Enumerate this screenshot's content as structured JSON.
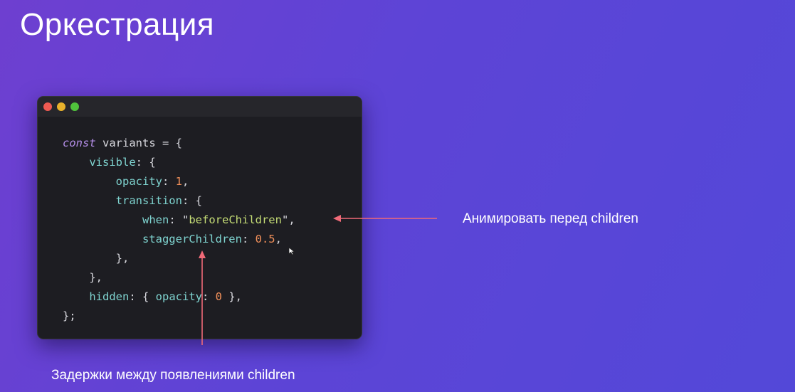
{
  "slide": {
    "title": "Оркестрация"
  },
  "code_window": {
    "lines": [
      {
        "tokens": [
          {
            "t": "const",
            "c": "kw"
          },
          {
            "t": " variants = {",
            "c": "var"
          }
        ]
      },
      {
        "tokens": [
          {
            "t": "    ",
            "c": "var"
          },
          {
            "t": "visible",
            "c": "prop"
          },
          {
            "t": ": {",
            "c": "punct"
          }
        ]
      },
      {
        "tokens": [
          {
            "t": "        ",
            "c": "var"
          },
          {
            "t": "opacity",
            "c": "prop"
          },
          {
            "t": ": ",
            "c": "punct"
          },
          {
            "t": "1",
            "c": "num"
          },
          {
            "t": ",",
            "c": "punct"
          }
        ]
      },
      {
        "tokens": [
          {
            "t": "        ",
            "c": "var"
          },
          {
            "t": "transition",
            "c": "prop"
          },
          {
            "t": ": {",
            "c": "punct"
          }
        ]
      },
      {
        "tokens": [
          {
            "t": "            ",
            "c": "var"
          },
          {
            "t": "when",
            "c": "prop"
          },
          {
            "t": ": ",
            "c": "punct"
          },
          {
            "t": "\"",
            "c": "str-q"
          },
          {
            "t": "beforeChildren",
            "c": "str"
          },
          {
            "t": "\"",
            "c": "str-q"
          },
          {
            "t": ",",
            "c": "punct"
          }
        ]
      },
      {
        "tokens": [
          {
            "t": "            ",
            "c": "var"
          },
          {
            "t": "staggerChildren",
            "c": "prop"
          },
          {
            "t": ": ",
            "c": "punct"
          },
          {
            "t": "0.5",
            "c": "num"
          },
          {
            "t": ",",
            "c": "punct"
          }
        ]
      },
      {
        "tokens": [
          {
            "t": "        },",
            "c": "punct"
          }
        ]
      },
      {
        "tokens": [
          {
            "t": "    },",
            "c": "punct"
          }
        ]
      },
      {
        "tokens": [
          {
            "t": "    ",
            "c": "var"
          },
          {
            "t": "hidden",
            "c": "prop"
          },
          {
            "t": ": { ",
            "c": "punct"
          },
          {
            "t": "opacity",
            "c": "prop"
          },
          {
            "t": ": ",
            "c": "punct"
          },
          {
            "t": "0",
            "c": "num"
          },
          {
            "t": " },",
            "c": "punct"
          }
        ]
      },
      {
        "tokens": [
          {
            "t": "};",
            "c": "punct"
          }
        ]
      }
    ]
  },
  "annotations": {
    "before_children": "Анимировать перед children",
    "stagger": "Задержки между появлениями children"
  },
  "colors": {
    "arrow": "#f06a78",
    "background_start": "#6e3fd0",
    "background_end": "#5348d8"
  },
  "icons": {
    "window_controls": [
      "close-dot",
      "minimize-dot",
      "maximize-dot"
    ],
    "pointer": "mouse-cursor-icon"
  }
}
